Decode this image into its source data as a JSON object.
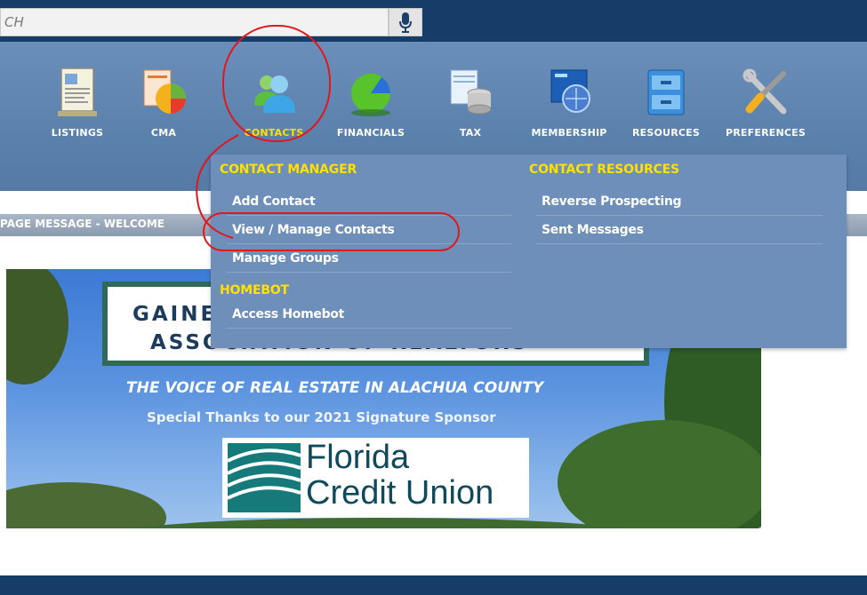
{
  "search": {
    "placeholder": "CH"
  },
  "nav": {
    "items": [
      {
        "label": "LISTINGS",
        "icon": "listings-icon"
      },
      {
        "label": "CMA",
        "icon": "cma-icon"
      },
      {
        "label": "CONTACTS",
        "icon": "contacts-icon"
      },
      {
        "label": "FINANCIALS",
        "icon": "financials-icon"
      },
      {
        "label": "TAX",
        "icon": "tax-icon"
      },
      {
        "label": "MEMBERSHIP",
        "icon": "membership-icon"
      },
      {
        "label": "RESOURCES",
        "icon": "resources-icon"
      },
      {
        "label": "PREFERENCES",
        "icon": "preferences-icon"
      }
    ],
    "active": "CONTACTS"
  },
  "message": {
    "text": "PAGE MESSAGE - WELCOME"
  },
  "dropdown": {
    "col1_header": "CONTACT MANAGER",
    "col1_items": [
      "Add Contact",
      "View / Manage Contacts",
      "Manage Groups"
    ],
    "homebot_header": "HOMEBOT",
    "homebot_items": [
      "Access Homebot"
    ],
    "col2_header": "CONTACT RESOURCES",
    "col2_items": [
      "Reverse Prospecting",
      "Sent Messages"
    ]
  },
  "banner": {
    "org_line1": "GAINESVILLE ALACHUA COUNTY",
    "org_line2": "ASSOCIATION OF REALTORS",
    "tagline": "THE VOICE OF REAL ESTATE IN ALACHUA COUNTY",
    "sponsor_line": "Special Thanks to our 2021 Signature Sponsor",
    "sponsor_name_1": "Florida",
    "sponsor_name_2": "Credit Union"
  },
  "colors": {
    "accent": "#ffe000",
    "nav_bg": "#5b81ad",
    "topbar": "#163d68",
    "annotation": "#e3161c"
  }
}
